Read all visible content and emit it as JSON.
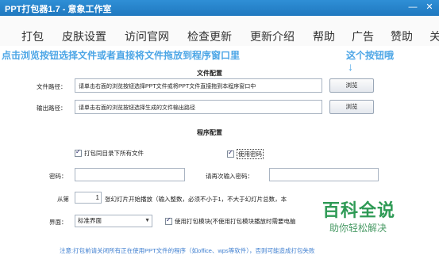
{
  "window": {
    "title": "PPT打包器1.7 - 意象工作室",
    "minimize_glyph": "—",
    "close_glyph": "✕"
  },
  "menu": [
    "打包",
    "皮肤设置",
    "访问官网",
    "检查更新",
    "更新介绍",
    "帮助",
    "广告",
    "赞助",
    "关"
  ],
  "hint": {
    "left": "点击浏览按钮选择文件或者直接将文件拖放到程序窗口里",
    "right": "这个按钮哦",
    "arrow": "↓"
  },
  "file_config": {
    "title": "文件配置",
    "path_label": "文件路径：",
    "path_value": "请单击右面的浏览按钮选择PPT文件或将PPT文件直接拖到本程序窗口中",
    "output_label": "输出路径：",
    "output_value": "请单击右面的浏览按钮选择生成的文件输出路径",
    "browse_label": "浏览"
  },
  "program_config": {
    "title": "程序配置",
    "pack_all_label": "打包同目录下所有文件",
    "pack_all_checked": true,
    "use_password_label": "使用密码",
    "use_password_checked": true,
    "password_label": "密码：",
    "password_confirm_label": "请再次输入密码：",
    "from_label": "从第",
    "from_value": "1",
    "slide_text": "张幻灯片开始播放（输入整数，必须不小于1，不大于幻灯片总数，本",
    "ui_label": "界面：",
    "ui_value": "标准界面",
    "use_pack_module_label": "使用打包模块(不使用打包模块播放时需要电脑",
    "use_pack_module_checked": true
  },
  "footer": {
    "note": "注意:打包前请关闭所有正在使用PPT文件的程序（如office、wps等软件），否则可能造成打包失败"
  },
  "watermark": {
    "main": "百科全说",
    "sub": "助你轻松解决"
  },
  "colors": {
    "titlebar": "#1f78bf",
    "hint": "#4da6e6",
    "footer_note": "#3f7fd0",
    "watermark": "#2e9a55"
  }
}
